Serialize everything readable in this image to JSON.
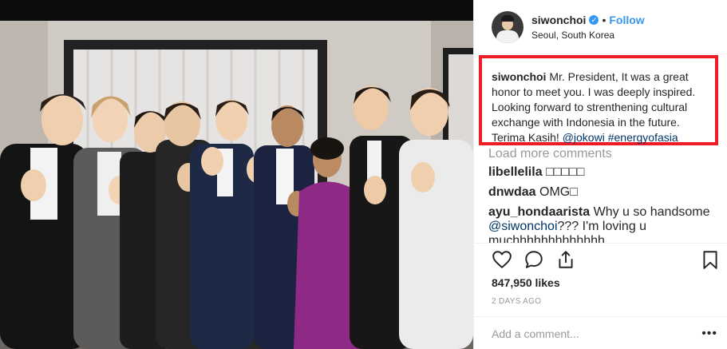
{
  "header": {
    "username": "siwonchoi",
    "dot": "•",
    "follow_label": "Follow",
    "location": "Seoul, South Korea",
    "verified_mark": "✓"
  },
  "caption": {
    "username": "siwonchoi",
    "text": "Mr. President, It was a great honor to meet you. I was deeply inspired. Looking forward to strenthening cultural exchange with Indonesia in the future. Terima Kasih!",
    "mention": "@jokowi",
    "hashtag": "#energyofasia"
  },
  "comments": {
    "load_more_label": "Load more comments",
    "items": [
      {
        "username": "libellelila",
        "text": "□□□□□"
      },
      {
        "username": "dnwdaa",
        "text": "OMG□"
      },
      {
        "username": "ayu_hondaarista",
        "text": "Why u so handsome",
        "mention": "@siwonchoi",
        "text2": "??? I'm loving u muchhhhhhhhhhhhh"
      }
    ]
  },
  "icons": {
    "like": "heart-icon",
    "comment": "comment-bubble-icon",
    "share": "share-icon",
    "save": "bookmark-icon"
  },
  "likes_label": "847,950 likes",
  "date_label": "2 DAYS AGO",
  "add_comment_placeholder": "Add a comment...",
  "more_label": "•••",
  "colors": {
    "accent": "#3897f0",
    "highlight_box": "#ee1c25",
    "muted": "#999999"
  }
}
